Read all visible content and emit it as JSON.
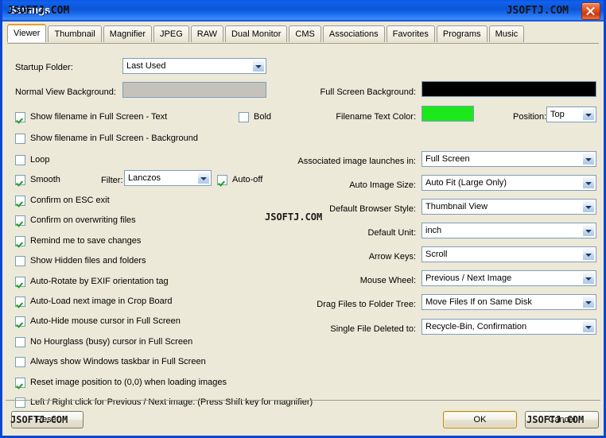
{
  "window": {
    "title": "Settings",
    "close_label": "close-icon",
    "watermark": "JSOFTJ.COM"
  },
  "tabs": [
    {
      "label": "Viewer",
      "active": true
    },
    {
      "label": "Thumbnail",
      "active": false
    },
    {
      "label": "Magnifier",
      "active": false
    },
    {
      "label": "JPEG",
      "active": false
    },
    {
      "label": "RAW",
      "active": false
    },
    {
      "label": "Dual Monitor",
      "active": false
    },
    {
      "label": "CMS",
      "active": false
    },
    {
      "label": "Associations",
      "active": false
    },
    {
      "label": "Favorites",
      "active": false
    },
    {
      "label": "Programs",
      "active": false
    },
    {
      "label": "Music",
      "active": false
    }
  ],
  "left": {
    "startup_folder_label": "Startup Folder:",
    "startup_folder_value": "Last Used",
    "normal_view_bg_label": "Normal View Background:",
    "normal_view_bg_color": "#C5C2BC",
    "filter_label": "Filter:",
    "filter_value": "Lanczos",
    "checkboxes": [
      {
        "label": "Show  filename in Full Screen - Text",
        "checked": true
      },
      {
        "label": "Bold",
        "checked": false
      },
      {
        "label": "Show  filename in Full Screen - Background",
        "checked": false
      },
      {
        "label": "Loop",
        "checked": false
      },
      {
        "label": "Smooth",
        "checked": true
      },
      {
        "label": "Auto-off",
        "checked": true
      },
      {
        "label": "Confirm on ESC exit",
        "checked": true
      },
      {
        "label": "Confirm on overwriting files",
        "checked": true
      },
      {
        "label": "Remind me to save changes",
        "checked": true
      },
      {
        "label": "Show Hidden files and folders",
        "checked": false
      },
      {
        "label": "Auto-Rotate by EXIF orientation tag",
        "checked": true
      },
      {
        "label": "Auto-Load next image in Crop Board",
        "checked": true
      },
      {
        "label": "Auto-Hide mouse cursor in Full Screen",
        "checked": true
      },
      {
        "label": "No Hourglass (busy) cursor in Full Screen",
        "checked": false
      },
      {
        "label": "Always show Windows taskbar in Full Screen",
        "checked": false
      },
      {
        "label": "Reset image position to (0,0) when loading images",
        "checked": true
      },
      {
        "label": "Left / Right click for Previous / Next image. (Press Shift key for magnifier)",
        "checked": false
      }
    ]
  },
  "right": {
    "full_screen_bg_label": "Full Screen Background:",
    "full_screen_bg_color": "#000000",
    "filename_text_color_label": "Filename Text Color:",
    "filename_text_color": "#1BE81B",
    "position_label": "Position:",
    "position_value": "Top",
    "fields": [
      {
        "label": "Associated image launches in:",
        "value": "Full Screen"
      },
      {
        "label": "Auto Image Size:",
        "value": "Auto Fit (Large Only)"
      },
      {
        "label": "Default Browser Style:",
        "value": "Thumbnail View"
      },
      {
        "label": "Default Unit:",
        "value": "inch"
      },
      {
        "label": "Arrow Keys:",
        "value": "Scroll"
      },
      {
        "label": "Mouse Wheel:",
        "value": "Previous / Next Image"
      },
      {
        "label": "Drag Files to Folder Tree:",
        "value": "Move Files If on Same Disk"
      },
      {
        "label": "Single File Deleted to:",
        "value": "Recycle-Bin, Confirmation"
      }
    ]
  },
  "footer": {
    "reset_label": "Reset",
    "ok_label": "OK",
    "cancel_label": "Cancel"
  }
}
